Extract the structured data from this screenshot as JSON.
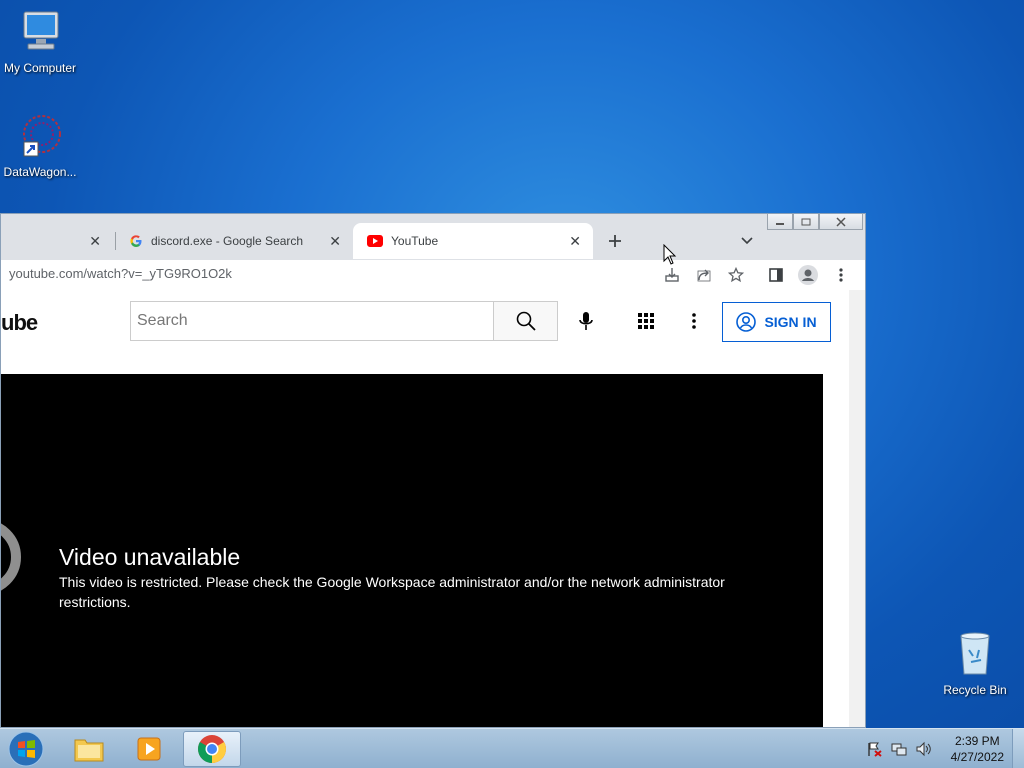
{
  "desktop": {
    "icons": [
      {
        "label": "My Computer"
      },
      {
        "label": "DataWagon..."
      },
      {
        "label": "Recycle Bin"
      }
    ]
  },
  "browser": {
    "tabs": [
      {
        "label": "discord.exe - Google Search"
      },
      {
        "label": "YouTube"
      }
    ],
    "url": "youtube.com/watch?v=_yTG9RO1O2k"
  },
  "youtube": {
    "logo_text": "ube",
    "search_placeholder": "Search",
    "sign_in_label": "SIGN IN",
    "error_title": "Video unavailable",
    "error_message": "This video is restricted. Please check the Google Workspace administrator and/or the network administrator restrictions."
  },
  "taskbar": {
    "time": "2:39 PM",
    "date": "4/27/2022"
  },
  "colors": {
    "youtube_red": "#ff0000",
    "sign_in_blue": "#065fd4",
    "desktop_blue": "#1a6fd0"
  }
}
